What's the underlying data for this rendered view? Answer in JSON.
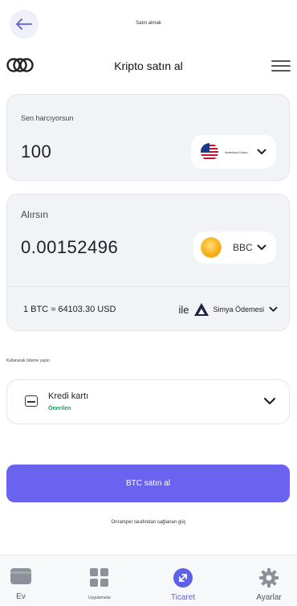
{
  "top": {
    "title": "Satın almak"
  },
  "header": {
    "title": "Kripto satın al"
  },
  "spend": {
    "label": "Sen harcıyorsun",
    "amount": "100",
    "currency": "Amerikan Doları"
  },
  "receive": {
    "label": "Alırsın",
    "amount": "0.00152496",
    "currency": "BBC"
  },
  "rate": {
    "text": "1 BTC ≈ 64103.30 USD"
  },
  "provider": {
    "prefix": "ile",
    "name": "Simya Ödemesi"
  },
  "payment": {
    "label": "Kullanarak ödeme yapın",
    "method": "Kredi kartı",
    "badge": "Önerilen"
  },
  "cta": {
    "label": "BTC satın al"
  },
  "powered_by": "Onramper tarafından sağlanan güç",
  "nav": {
    "items": [
      {
        "label": "Ev"
      },
      {
        "label": "Uygulamalar"
      },
      {
        "label": "Ticaret"
      },
      {
        "label": "Ayarlar"
      }
    ],
    "active": "Ticaret"
  },
  "colors": {
    "accent": "#6a63ef",
    "recommended": "#1f9d55",
    "card_bg": "#f1f3f6"
  },
  "icons": [
    "back-arrow-icon",
    "toggle-logo-icon",
    "menu-icon",
    "us-flag-icon",
    "chevron-down-icon",
    "bitcoin-coin-icon",
    "alchemy-logo-icon",
    "credit-card-icon",
    "wallet-icon",
    "apps-grid-icon",
    "trade-icon",
    "settings-gear-icon"
  ]
}
